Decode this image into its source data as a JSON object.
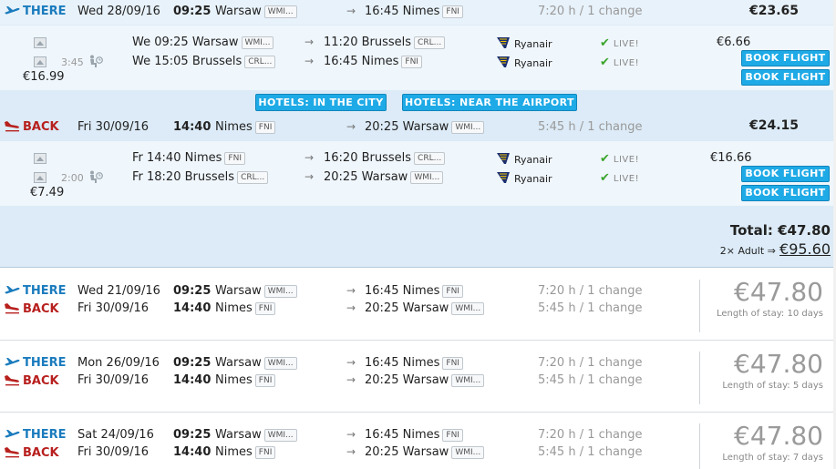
{
  "labels": {
    "there": "THERE",
    "back": "BACK",
    "live": "LIVE!",
    "book": "BOOK FLIGHT",
    "hotels_city": "HOTELS: IN THE CITY",
    "hotels_airport": "HOTELS: NEAR THE AIRPORT",
    "total_label": "Total:",
    "adult_label": "2× Adult ⇒",
    "length_of_stay": "Length of stay:"
  },
  "expanded": {
    "outbound": {
      "date": "Wed 28/09/16",
      "dep_time": "09:25",
      "dep_city": "Warsaw",
      "dep_code": "WMI...",
      "arr_time": "16:45",
      "arr_city": "Nimes",
      "arr_code": "FNI",
      "duration": "7:20 h / 1 change",
      "price": "€23.65",
      "layover": "3:45",
      "leg_total": "€16.99",
      "legs": [
        {
          "day_time": "We 09:25",
          "from": "Warsaw",
          "from_code": "WMI...",
          "to_time": "11:20",
          "to": "Brussels",
          "to_code": "CRL...",
          "airline": "Ryanair",
          "price": "€6.66"
        },
        {
          "day_time": "We 15:05",
          "from": "Brussels",
          "from_code": "CRL...",
          "to_time": "16:45",
          "to": "Nimes",
          "to_code": "FNI",
          "airline": "Ryanair",
          "price": ""
        }
      ]
    },
    "inbound": {
      "date": "Fri 30/09/16",
      "dep_time": "14:40",
      "dep_city": "Nimes",
      "dep_code": "FNI",
      "arr_time": "20:25",
      "arr_city": "Warsaw",
      "arr_code": "WMI...",
      "duration": "5:45 h / 1 change",
      "price": "€24.15",
      "layover": "2:00",
      "leg_total": "€7.49",
      "legs": [
        {
          "day_time": "Fr 14:40",
          "from": "Nimes",
          "from_code": "FNI",
          "to_time": "16:20",
          "to": "Brussels",
          "to_code": "CRL...",
          "airline": "Ryanair",
          "price": "€16.66"
        },
        {
          "day_time": "Fr 18:20",
          "from": "Brussels",
          "from_code": "CRL...",
          "to_time": "20:25",
          "to": "Warsaw",
          "to_code": "WMI...",
          "airline": "Ryanair",
          "price": ""
        }
      ]
    },
    "total": "€47.80",
    "adult_total": "€95.60"
  },
  "trips": [
    {
      "out_date": "Wed 21/09/16",
      "out_dep_time": "09:25",
      "out_dep_city": "Warsaw",
      "out_dep_code": "WMI...",
      "out_arr_time": "16:45",
      "out_arr_city": "Nimes",
      "out_arr_code": "FNI",
      "out_duration": "7:20 h / 1 change",
      "back_date": "Fri 30/09/16",
      "back_dep_time": "14:40",
      "back_dep_city": "Nimes",
      "back_dep_code": "FNI",
      "back_arr_time": "20:25",
      "back_arr_city": "Warsaw",
      "back_arr_code": "WMI...",
      "back_duration": "5:45 h / 1 change",
      "price": "€47.80",
      "stay": "10 days"
    },
    {
      "out_date": "Mon 26/09/16",
      "out_dep_time": "09:25",
      "out_dep_city": "Warsaw",
      "out_dep_code": "WMI...",
      "out_arr_time": "16:45",
      "out_arr_city": "Nimes",
      "out_arr_code": "FNI",
      "out_duration": "7:20 h / 1 change",
      "back_date": "Fri 30/09/16",
      "back_dep_time": "14:40",
      "back_dep_city": "Nimes",
      "back_dep_code": "FNI",
      "back_arr_time": "20:25",
      "back_arr_city": "Warsaw",
      "back_arr_code": "WMI...",
      "back_duration": "5:45 h / 1 change",
      "price": "€47.80",
      "stay": "5 days"
    },
    {
      "out_date": "Sat 24/09/16",
      "out_dep_time": "09:25",
      "out_dep_city": "Warsaw",
      "out_dep_code": "WMI...",
      "out_arr_time": "16:45",
      "out_arr_city": "Nimes",
      "out_arr_code": "FNI",
      "out_duration": "7:20 h / 1 change",
      "back_date": "Fri 30/09/16",
      "back_dep_time": "14:40",
      "back_dep_city": "Nimes",
      "back_dep_code": "FNI",
      "back_arr_time": "20:25",
      "back_arr_city": "Warsaw",
      "back_arr_code": "WMI...",
      "back_duration": "5:45 h / 1 change",
      "price": "€47.80",
      "stay": "7 days"
    }
  ],
  "colors": {
    "there": "#1a7bbd",
    "back": "#b7201e",
    "button": "#1eaae6",
    "live_check": "#3aa52a"
  },
  "icons": {
    "there": "plane-takeoff-icon",
    "back": "plane-landing-icon",
    "airline": "ryanair-harp-icon",
    "layover": "waiting-person-icon",
    "live": "check-icon",
    "thumb": "image-thumbnail-icon"
  }
}
